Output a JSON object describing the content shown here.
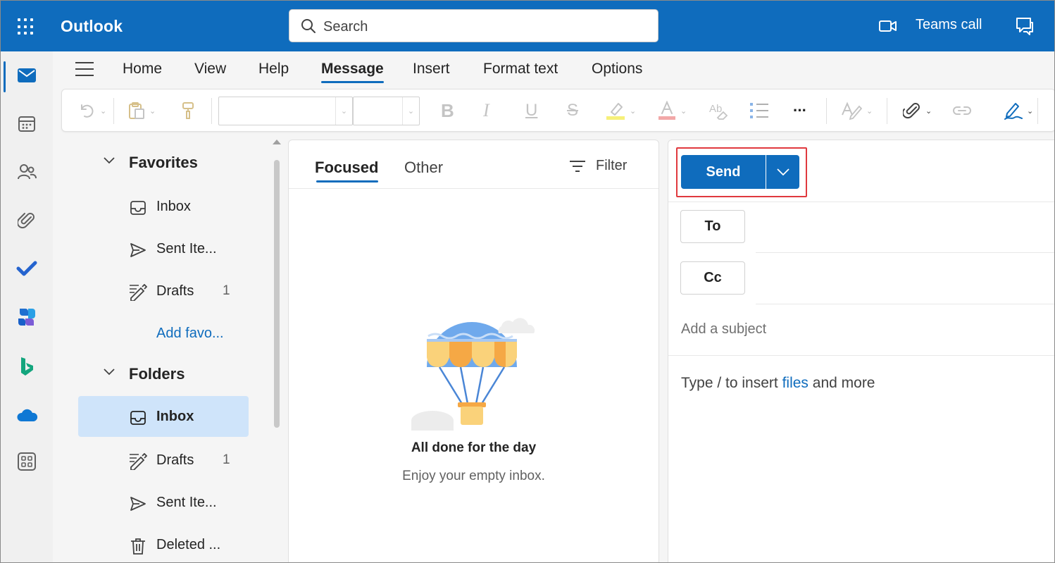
{
  "app": {
    "title": "Outlook"
  },
  "search": {
    "placeholder": "Search"
  },
  "header": {
    "teams_call": "Teams call"
  },
  "ribbon": {
    "tabs": [
      "Home",
      "View",
      "Help",
      "Message",
      "Insert",
      "Format text",
      "Options"
    ],
    "active_tab": "Message"
  },
  "toolbar": {
    "font_name": "",
    "font_size": "",
    "bold": "B",
    "italic": "I",
    "underline": "U",
    "strike": "S",
    "more": "···"
  },
  "folders": {
    "favorites_heading": "Favorites",
    "favorites": [
      {
        "label": "Inbox",
        "count": ""
      },
      {
        "label": "Sent Ite...",
        "count": ""
      },
      {
        "label": "Drafts",
        "count": "1"
      }
    ],
    "add_favorite": "Add favo...",
    "folders_heading": "Folders",
    "items": [
      {
        "label": "Inbox",
        "count": ""
      },
      {
        "label": "Drafts",
        "count": "1"
      },
      {
        "label": "Sent Ite...",
        "count": ""
      },
      {
        "label": "Deleted ...",
        "count": ""
      }
    ]
  },
  "message_list": {
    "tabs": {
      "focused": "Focused",
      "other": "Other"
    },
    "filter": "Filter",
    "empty_title": "All done for the day",
    "empty_subtitle": "Enjoy your empty inbox."
  },
  "compose": {
    "send": "Send",
    "to": "To",
    "cc": "Cc",
    "subject_placeholder": "Add a subject",
    "body_hint": {
      "before": "Type / to insert ",
      "link": "files",
      "after": " and more"
    }
  },
  "colors": {
    "brand": "#0f6cbd",
    "selected_folder": "#cfe4fa",
    "highlight_box": "#e0393e"
  }
}
